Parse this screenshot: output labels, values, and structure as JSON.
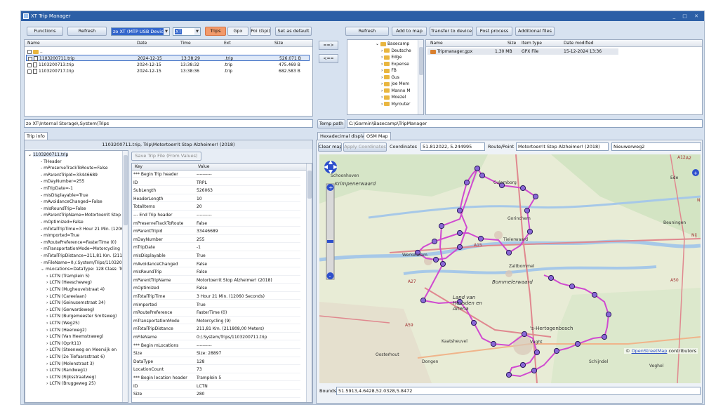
{
  "window": {
    "title": "XT Trip Manager",
    "controls": "_ □ ✕"
  },
  "left_toolbar": {
    "functions": "Functions",
    "refresh": "Refresh",
    "device": "zo XT (MTP USB Device)",
    "device_num": "XT",
    "trips": "Trips",
    "gpx": "Gpx",
    "poi": "Poi (Gpi)",
    "set_default": "Set as default"
  },
  "file_table": {
    "headers": [
      "Name",
      "Date",
      "Time",
      "Ext",
      "Size"
    ],
    "rows": [
      {
        "name": "1103200711.trip",
        "date": "2024-12-15",
        "time": "13:38:29",
        "ext": ".trip",
        "size": "526.071 B"
      },
      {
        "name": "1103200713.trip",
        "date": "2024-12-15",
        "time": "13:38:32",
        "ext": ".trip",
        "size": "475.469 B"
      },
      {
        "name": "1103200717.trip",
        "date": "2024-12-15",
        "time": "13:38:36",
        "ext": ".trip",
        "size": "682.583 B"
      }
    ],
    "parent": ".."
  },
  "left_path": "zo XT\\Internal Storage\\.System\\Trips",
  "transfer": {
    "to_right": "==>",
    "to_left": "<=="
  },
  "right_toolbar": {
    "refresh": "Refresh",
    "add_to_map": "Add to map",
    "transfer_device": "Transfer to device",
    "post_process": "Post process",
    "additional": "Additional files"
  },
  "folder_tree": [
    "Basecamp",
    "Deutsche",
    "Edge",
    "Expense",
    "FB",
    "Gus",
    "Joe Mem",
    "Manno M",
    "Moezel",
    "Myrouter"
  ],
  "right_files": {
    "headers": [
      "Name",
      "Size",
      "Item type",
      "Date modified"
    ],
    "rows": [
      {
        "name": "Tripmanager.gpx",
        "size": "1,30 MB",
        "type": "GPX File",
        "date": "15-12-2024 13:36"
      }
    ]
  },
  "temp_path": {
    "label": "Temp path",
    "value": "C:\\Garmin\\Basecamp\\TripManager"
  },
  "tripinfo": {
    "tab": "Trip info",
    "caption": "1103200711.trip, Trip\\Motortoerrit Stop Alzheimer! (2018)",
    "save": "Save Trip File (From Values)",
    "tree": [
      "1103200711.trip",
      "THeader",
      "mPreserveTrackToRoute=False",
      "mParentTripId=33446689",
      "mDayNumber=255",
      "mTripDate=-1",
      "mIsDisplayable=True",
      "mAvoidanceChanged=False",
      "mIsRoundTrip=False",
      "mParentTripName=Motortoerrit Stop",
      "mOptimized=False",
      "mTotalTripTime=3 Hour 21 Min. (1206",
      "mImported=True",
      "mRoutePreference=FasterTime (0)",
      "mTransportationMode=Motorcycling",
      "mTotalTripDistance=211,81 Km. (211",
      "mFileName=0:/.System/Trips/110320",
      "mLocations=DataType: 128 Class: Tr",
      "LCTN (Tramplein 5)",
      "LCTN (Heescheweg)",
      "LCTN (Mugheuvelstraat 4)",
      "LCTN (Careelaan)",
      "LCTN (Geinusemstraat 34)",
      "LCTN (Gerwardeweg)",
      "LCTN (Burgemeester Smitsweg)",
      "LCTN (Weg25)",
      "LCTN (Heerweg2)",
      "LCTN (Van Heemstraweg)",
      "LCTN (Oprit11)",
      "LCTN (Steenweg en Meervijk en",
      "LCTN (2e Tiefaarsstraat 6)",
      "LCTN (Molenstraat 3)",
      "LCTN (Randweg1)",
      "LCTN (Rijksstraatweg)",
      "LCTN (Bruggeweg 25)"
    ],
    "kv_headers": [
      "Key",
      "Value"
    ],
    "kv": [
      [
        "*** Begin Trip header",
        "----------"
      ],
      [
        "ID",
        "TRPL"
      ],
      [
        "SubLength",
        "526063"
      ],
      [
        "HeaderLength",
        "10"
      ],
      [
        "TotalItems",
        "20"
      ],
      [
        "--- End Trip header",
        "----------"
      ],
      [
        "mPreserveTrackToRoute",
        "False"
      ],
      [
        "mParentTripId",
        "33446689"
      ],
      [
        "mDayNumber",
        "255"
      ],
      [
        "mTripDate",
        "-1"
      ],
      [
        "mIsDisplayable",
        "True"
      ],
      [
        "mAvoidanceChanged",
        "False"
      ],
      [
        "mIsRoundTrip",
        "False"
      ],
      [
        "mParentTripName",
        "Motortoerrit Stop Alzheimer! (2018)"
      ],
      [
        "mOptimized",
        "False"
      ],
      [
        "mTotalTripTime",
        "3 Hour 21 Min. (12060 Seconds)"
      ],
      [
        "mImported",
        "True"
      ],
      [
        "mRoutePreference",
        "FasterTime (0)"
      ],
      [
        "mTransportationMode",
        "Motorcycling (9)"
      ],
      [
        "mTotalTripDistance",
        "211,81 Km. (211808,00 Meters)"
      ],
      [
        "mFileName",
        "0:/.System/Trips/1103200711.trip"
      ],
      [
        "*** Begin mLocations",
        "----------"
      ],
      [
        "Size",
        "Size: 28897"
      ],
      [
        "DataType",
        "128"
      ],
      [
        "LocationCount",
        "73"
      ],
      [
        "*** Begin location header",
        "Tramplein 5"
      ],
      [
        "ID",
        "LCTN"
      ],
      [
        "Size",
        "280"
      ]
    ]
  },
  "map_panel": {
    "tab_hex": "Hexadecimal display",
    "tab_osm": "OSM Map",
    "clear_map": "Clear map",
    "apply_coords": "Apply Coordinates",
    "coords_label": "Coordinates",
    "coords_value": "51.812022, 5.244995",
    "route_label": "Route/Point",
    "route_value": "Motortoerrit Stop Alzheimer! (2018)",
    "point_value": "Nieuwerweg2",
    "attribution_pre": "© ",
    "attribution_link": "OpenStreetMap",
    "attribution_post": " contributors",
    "bounds_label": "Bounds:",
    "bounds_value": "51.5913,4.6428,52.0328,5.8472",
    "places": [
      "Schoonhoven",
      "Krimpenerwaard",
      "Culemborg",
      "Tielerwaard",
      "Gorinchem",
      "Werkendam",
      "Zaltbommel",
      "Bommelerwaard",
      "Land van Heusden en Altena",
      "'s-Hertogenbosch",
      "Kaatsheuvel",
      "Vught",
      "Oosterhout",
      "Dongen",
      "Schijndel",
      "Beuningen",
      "Veghel",
      "Ede",
      "A15",
      "A27",
      "A2",
      "A59",
      "A50",
      "A12",
      "N",
      "Nij"
    ]
  }
}
